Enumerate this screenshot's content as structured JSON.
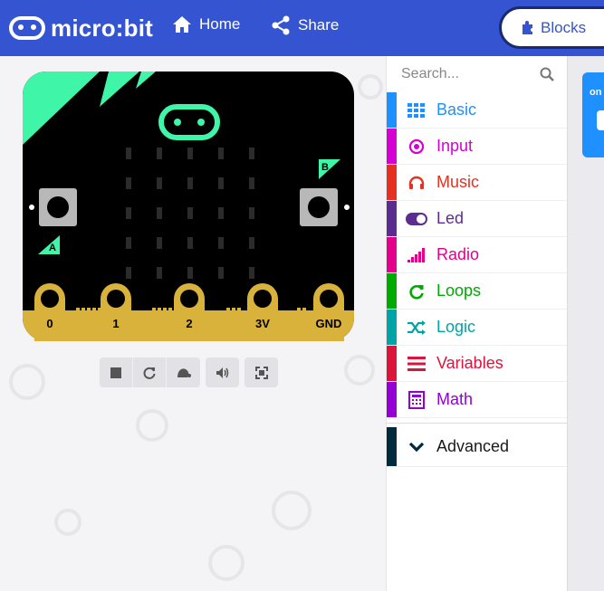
{
  "header": {
    "logo_text": "micro:bit",
    "nav": [
      {
        "label": "Home",
        "icon": "home-icon"
      },
      {
        "label": "Share",
        "icon": "share-icon"
      }
    ],
    "blocks_label": "Blocks"
  },
  "simulator": {
    "pin_labels": [
      "0",
      "1",
      "2",
      "3V",
      "GND"
    ],
    "button_labels": {
      "a": "A",
      "b": "B"
    },
    "controls": [
      "stop-icon",
      "restart-icon",
      "slow-motion-icon",
      "sound-icon",
      "fullscreen-icon"
    ]
  },
  "toolbox": {
    "search_placeholder": "Search...",
    "categories": [
      {
        "label": "Basic",
        "color": "#1e90ff",
        "icon": "grid-icon"
      },
      {
        "label": "Input",
        "color": "#d400d4",
        "icon": "input-target-icon"
      },
      {
        "label": "Music",
        "color": "#e63022",
        "icon": "headphones-icon"
      },
      {
        "label": "Led",
        "color": "#5c2d91",
        "icon": "toggle-icon"
      },
      {
        "label": "Radio",
        "color": "#e3008c",
        "icon": "signal-bars-icon"
      },
      {
        "label": "Loops",
        "color": "#00aa00",
        "icon": "refresh-icon"
      },
      {
        "label": "Logic",
        "color": "#00a4a6",
        "icon": "shuffle-icon"
      },
      {
        "label": "Variables",
        "color": "#dc143c",
        "icon": "list-icon"
      },
      {
        "label": "Math",
        "color": "#9400d3",
        "icon": "calculator-icon"
      }
    ],
    "advanced": {
      "label": "Advanced",
      "color": "#002b3d",
      "icon": "chevron-down-icon"
    }
  },
  "workspace": {
    "block_label": "on"
  }
}
